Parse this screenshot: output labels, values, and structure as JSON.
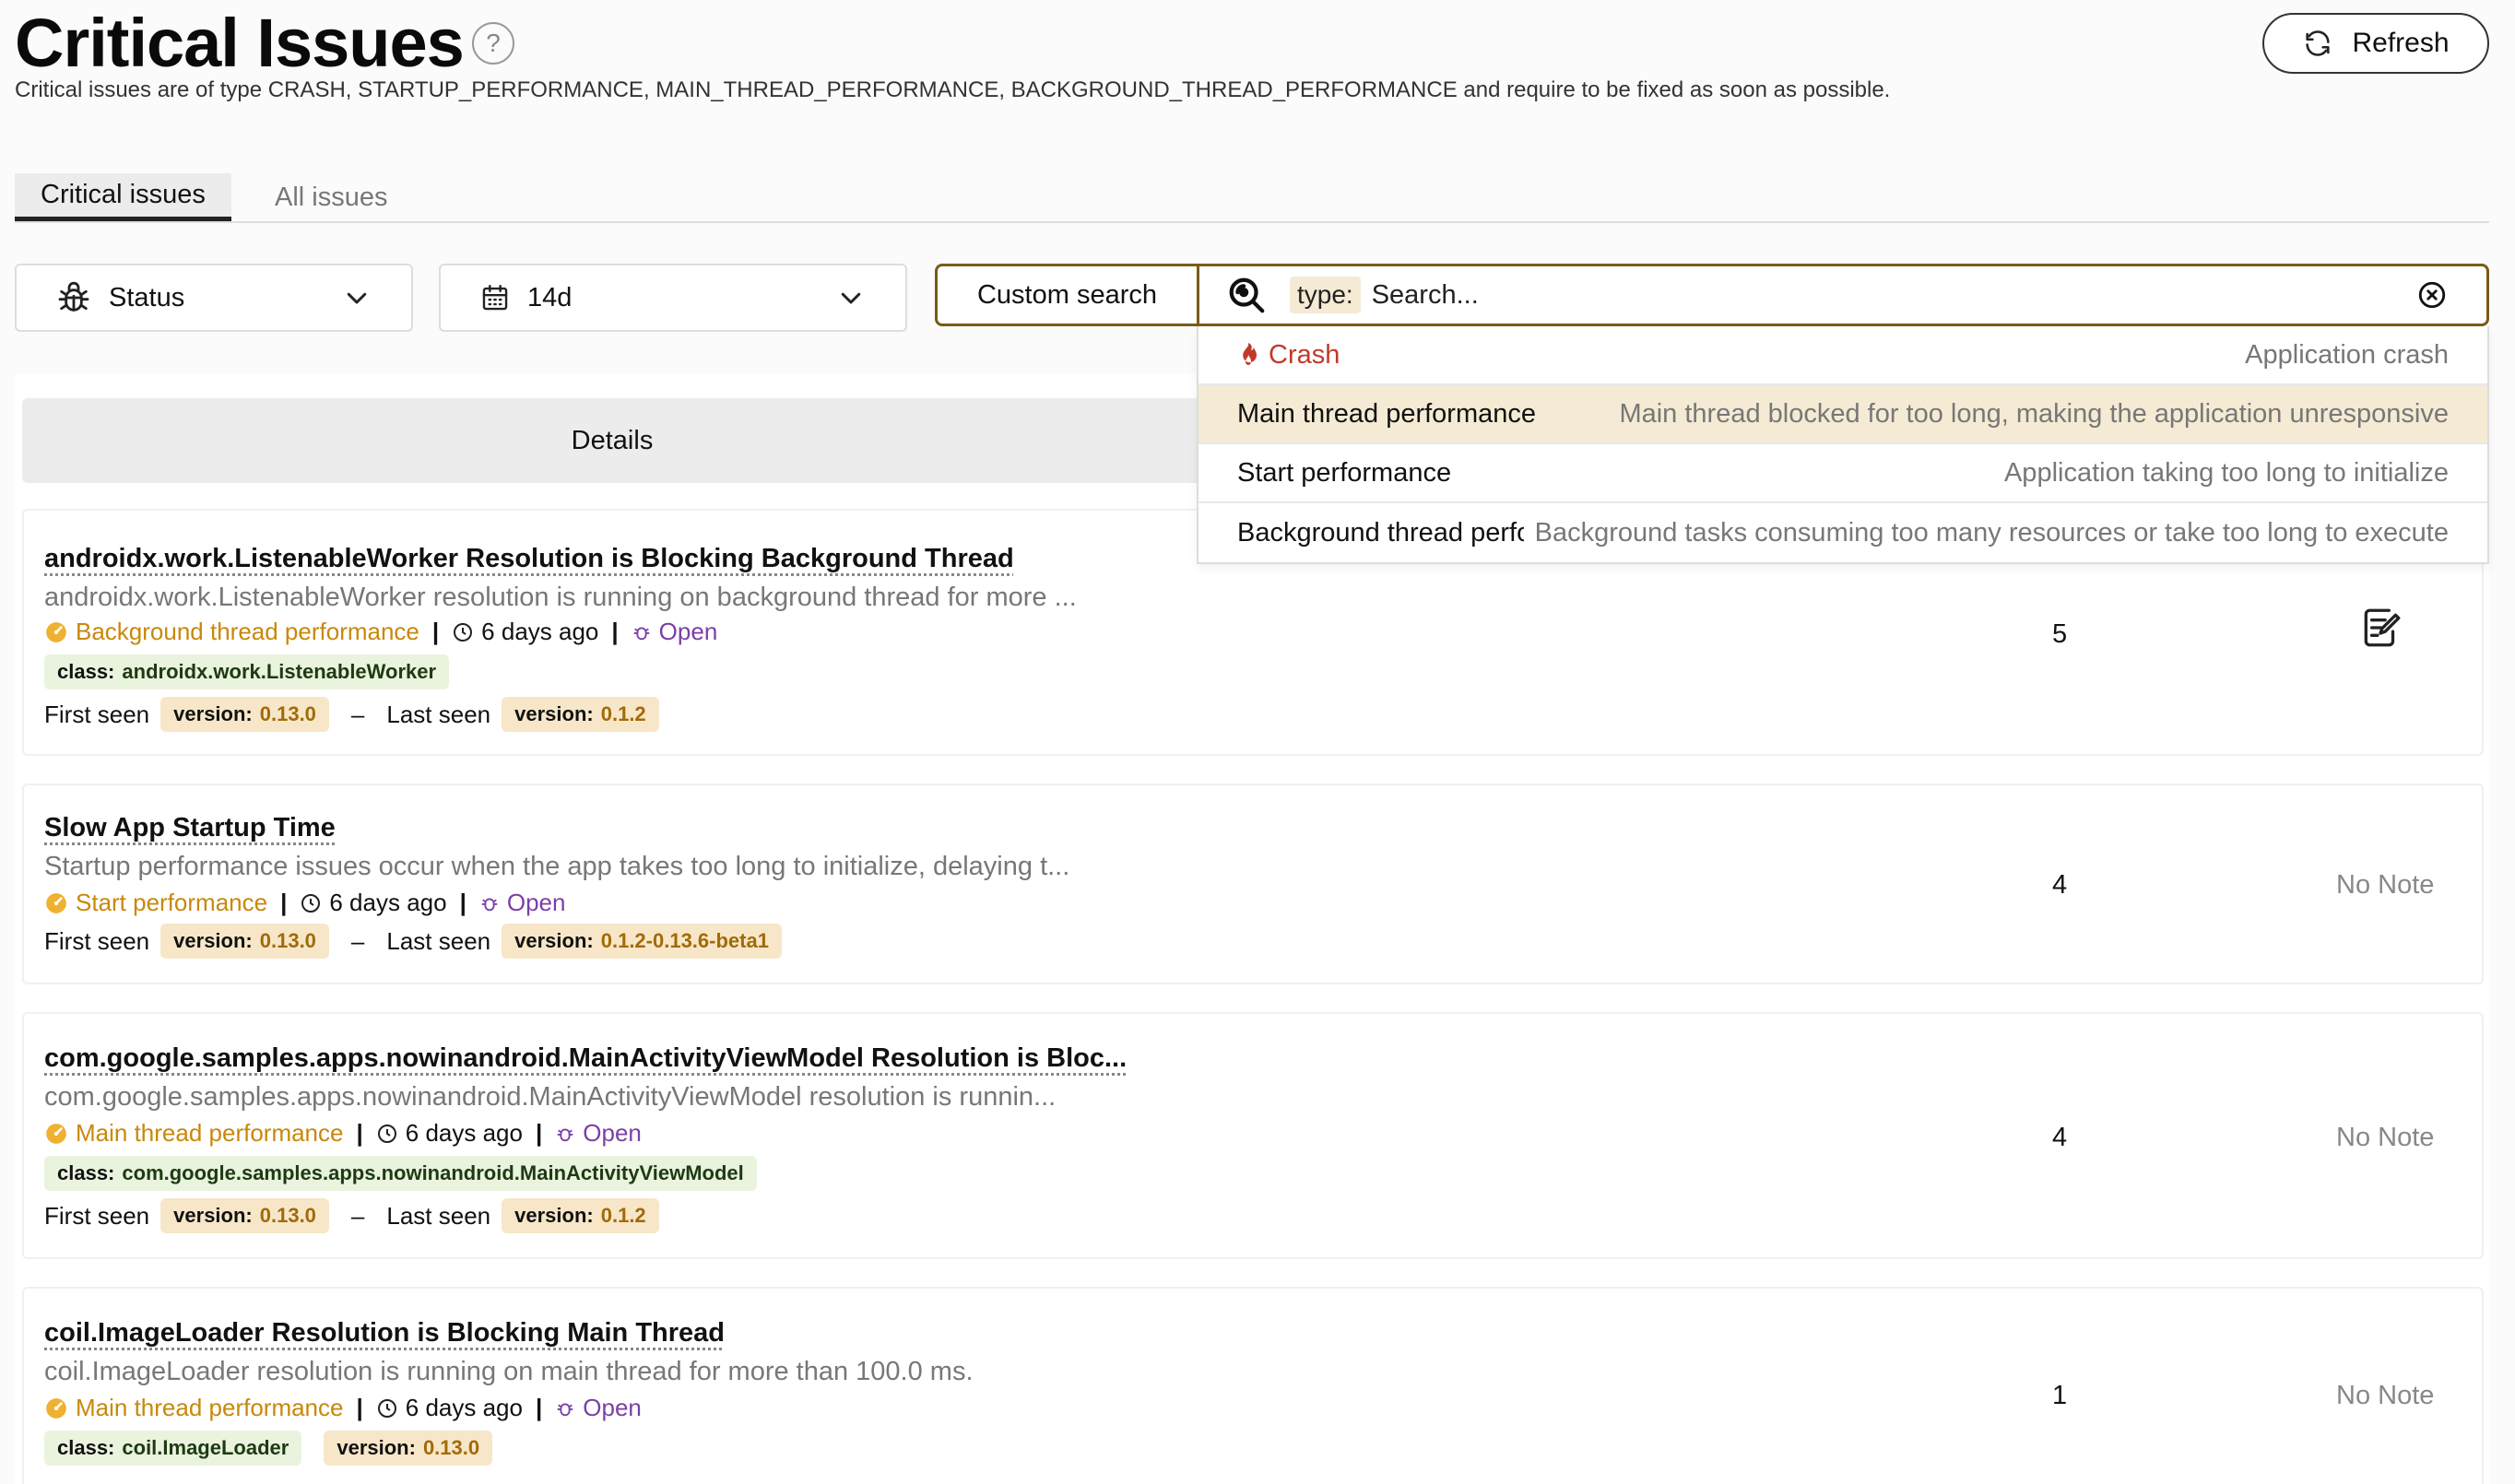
{
  "page": {
    "title": "Critical Issues",
    "help": "?",
    "subtitle": "Critical issues are of type CRASH, STARTUP_PERFORMANCE, MAIN_THREAD_PERFORMANCE, BACKGROUND_THREAD_PERFORMANCE and require to be fixed as soon as possible.",
    "refresh_label": "Refresh"
  },
  "tabs": [
    {
      "label": "Critical issues",
      "active": true
    },
    {
      "label": "All issues",
      "active": false
    }
  ],
  "filters": {
    "status_label": "Status",
    "date_label": "14d"
  },
  "search": {
    "custom_search_label": "Custom search",
    "type_chip": "type:",
    "placeholder": "Search..."
  },
  "dropdown": [
    {
      "label": "Crash",
      "desc": "Application crash",
      "highlight": false,
      "icon": "fire-icon"
    },
    {
      "label": "Main thread performance",
      "desc": "Main thread blocked for too long, making the application unresponsive",
      "highlight": true
    },
    {
      "label": "Start performance",
      "desc": "Application taking too long to initialize",
      "highlight": false
    },
    {
      "label": "Background thread performance",
      "desc": "Background tasks consuming too many resources or take too long to execute",
      "highlight": false
    }
  ],
  "table": {
    "details_header": "Details"
  },
  "issues": [
    {
      "title": "androidx.work.ListenableWorker Resolution is Blocking Background Thread",
      "desc": "androidx.work.ListenableWorker resolution is running on background thread for more ...",
      "type": "Background thread performance",
      "time": "6 days ago",
      "status": "Open",
      "class_key": "class:",
      "class_val": "androidx.work.ListenableWorker",
      "first_seen_label": "First seen",
      "first_version_key": "version:",
      "first_version": "0.13.0",
      "dash": "–",
      "last_seen_label": "Last seen",
      "last_version_key": "version:",
      "last_version": "0.1.2",
      "count": "5",
      "note": ""
    },
    {
      "title": "Slow App Startup Time",
      "desc": "Startup performance issues occur when the app takes too long to initialize, delaying t...",
      "type": "Start performance",
      "time": "6 days ago",
      "status": "Open",
      "first_seen_label": "First seen",
      "first_version_key": "version:",
      "first_version": "0.13.0",
      "dash": "–",
      "last_seen_label": "Last seen",
      "last_version_key": "version:",
      "last_version": "0.1.2-0.13.6-beta1",
      "count": "4",
      "note": "No Note"
    },
    {
      "title": "com.google.samples.apps.nowinandroid.MainActivityViewModel Resolution is Bloc...",
      "desc": "com.google.samples.apps.nowinandroid.MainActivityViewModel resolution is runnin...",
      "type": "Main thread performance",
      "time": "6 days ago",
      "status": "Open",
      "class_key": "class:",
      "class_val": "com.google.samples.apps.nowinandroid.MainActivityViewModel",
      "first_seen_label": "First seen",
      "first_version_key": "version:",
      "first_version": "0.13.0",
      "dash": "–",
      "last_seen_label": "Last seen",
      "last_version_key": "version:",
      "last_version": "0.1.2",
      "count": "4",
      "note": "No Note"
    },
    {
      "title": "coil.ImageLoader Resolution is Blocking Main Thread",
      "desc": "coil.ImageLoader resolution is running on main thread for more than 100.0 ms.",
      "type": "Main thread performance",
      "time": "6 days ago",
      "status": "Open",
      "class_key": "class:",
      "class_val": "coil.ImageLoader",
      "version_key": "version:",
      "version_val": "0.13.0",
      "count": "1",
      "note": "No Note"
    }
  ]
}
